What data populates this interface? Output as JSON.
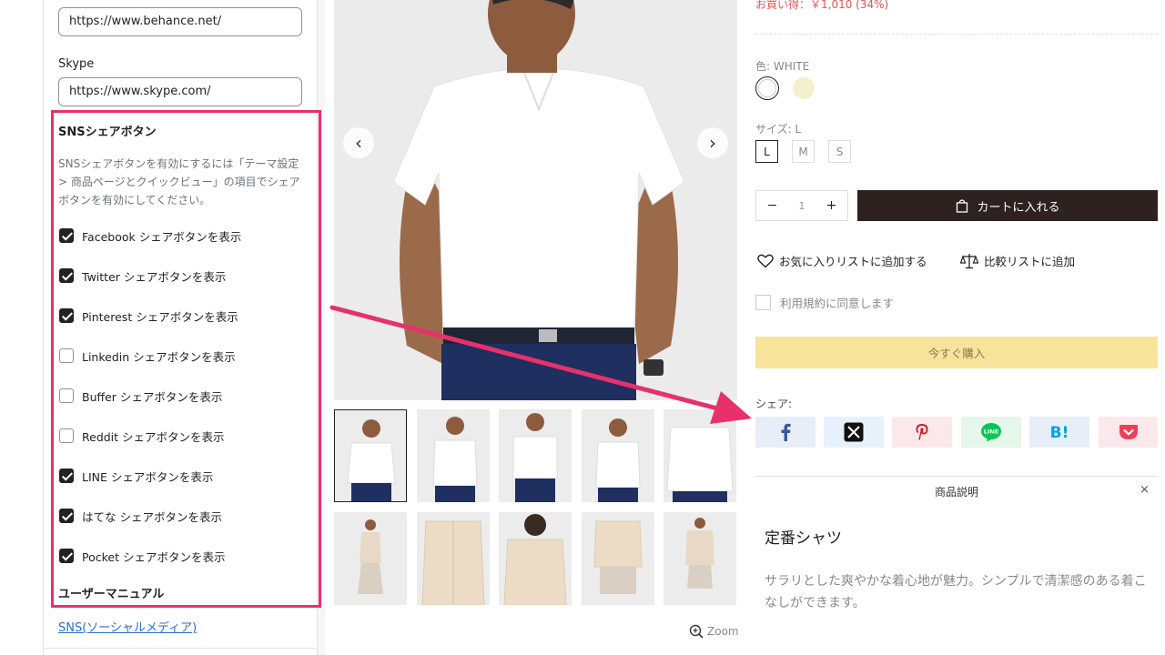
{
  "settings": {
    "behance_value": "https://www.behance.net/",
    "skype_label": "Skype",
    "skype_value": "https://www.skype.com/",
    "sns_title": "SNSシェアボタン",
    "sns_desc": "SNSシェアボタンを有効にするには「テーマ設定 > 商品ページとクイックビュー」の項目でシェアボタンを有効にしてください。",
    "checkboxes": [
      {
        "label": "Facebook シェアボタンを表示",
        "checked": true
      },
      {
        "label": "Twitter シェアボタンを表示",
        "checked": true
      },
      {
        "label": "Pinterest シェアボタンを表示",
        "checked": true
      },
      {
        "label": "Linkedin シェアボタンを表示",
        "checked": false
      },
      {
        "label": "Buffer シェアボタンを表示",
        "checked": false
      },
      {
        "label": "Reddit シェアボタンを表示",
        "checked": false
      },
      {
        "label": "LINE シェアボタンを表示",
        "checked": true
      },
      {
        "label": "はてな シェアボタンを表示",
        "checked": true
      },
      {
        "label": "Pocket シェアボタンを表示",
        "checked": true
      }
    ],
    "manual_title": "ユーザーマニュアル",
    "manual_link": "SNS(ソーシャルメディア)"
  },
  "gallery": {
    "zoom_label": "Zoom"
  },
  "product": {
    "discount_text": "お買い得：￥1,010 (34%)",
    "color_label": "色:",
    "color_value": "WHITE",
    "size_label": "サイズ:",
    "size_value": "L",
    "sizes": [
      "L",
      "M",
      "S"
    ],
    "quantity": "1",
    "qty_minus": "−",
    "qty_plus": "+",
    "cart_label": "カートに入れる",
    "wishlist_label": "お気に入りリストに追加する",
    "compare_label": "比較リストに追加",
    "terms_label": "利用規約に同意します",
    "buy_now_label": "今すぐ購入",
    "share_label": "シェア:",
    "desc_tab_label": "商品説明",
    "desc_close": "×",
    "desc_title": "定番シャツ",
    "desc_body": "サラリとした爽やかな着心地が魅力。シンプルで清潔感のある着こなしができます。"
  },
  "share_buttons": [
    {
      "name": "facebook",
      "glyph": "f",
      "bg": "#e8eef7",
      "color": "#3b5998"
    },
    {
      "name": "x",
      "glyph": "X",
      "bg": "#e6f1fb",
      "color": "#111111"
    },
    {
      "name": "pinterest",
      "glyph": "P",
      "bg": "#fbe8ea",
      "color": "#cb2027"
    },
    {
      "name": "line",
      "glyph": "LINE",
      "bg": "#e6f6ea",
      "color": "#06c755"
    },
    {
      "name": "hatena",
      "glyph": "B!",
      "bg": "#e6eef7",
      "color": "#00a4de"
    },
    {
      "name": "pocket",
      "glyph": "pocket",
      "bg": "#fbe8ec",
      "color": "#ef4056"
    }
  ],
  "colors": {
    "highlight": "#e6316d",
    "cart_bg": "#2d2220",
    "buy_bg": "#f8e39a",
    "discount": "#e05353"
  }
}
